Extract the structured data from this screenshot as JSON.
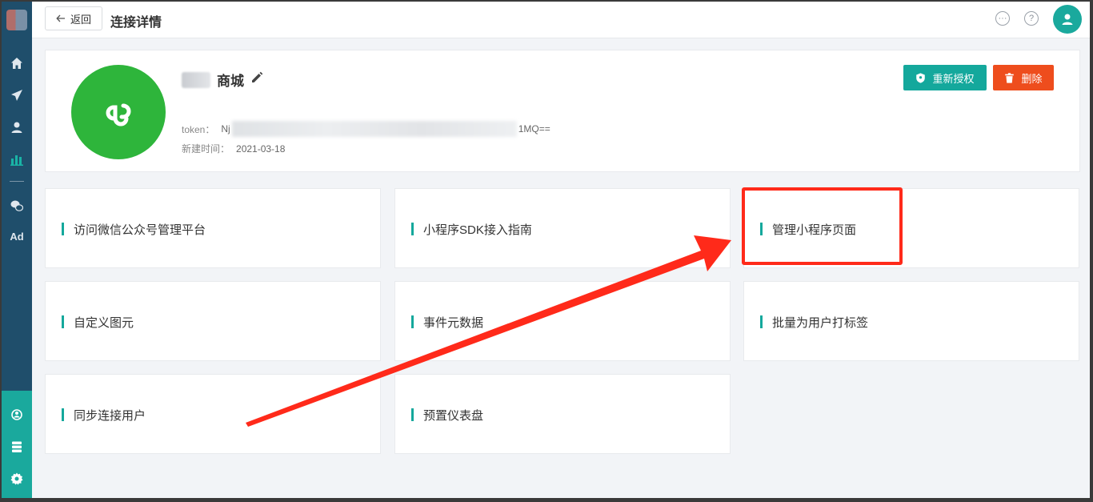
{
  "topbar": {
    "back_label": "返回",
    "title": "连接详情",
    "icons": [
      "chat-icon",
      "help-icon",
      "user-avatar-icon"
    ]
  },
  "sidebar": {
    "icons": [
      "home-icon",
      "send-icon",
      "user-icon",
      "chart-icon",
      "wechat-icon"
    ],
    "ad_label": "Ad",
    "bottom_icons": [
      "network-icon",
      "database-icon",
      "settings-icon"
    ]
  },
  "info": {
    "app_name": "商城",
    "token_label": "token：",
    "token_start": "Nj",
    "token_end": "1MQ==",
    "created_label": "新建时间：",
    "created_date": "2021-03-18",
    "reauth_label": "重新授权",
    "delete_label": "删除"
  },
  "tiles": [
    "访问微信公众号管理平台",
    "小程序SDK接入指南",
    "管理小程序页面",
    "自定义图元",
    "事件元数据",
    "批量为用户打标签",
    "同步连接用户",
    "预置仪表盘"
  ],
  "colors": {
    "accent": "#14a89c",
    "danger": "#ee4d1d",
    "sidebar": "#1f4e6b",
    "annotation": "#ff2a1a",
    "app_logo": "#2eb53b"
  }
}
